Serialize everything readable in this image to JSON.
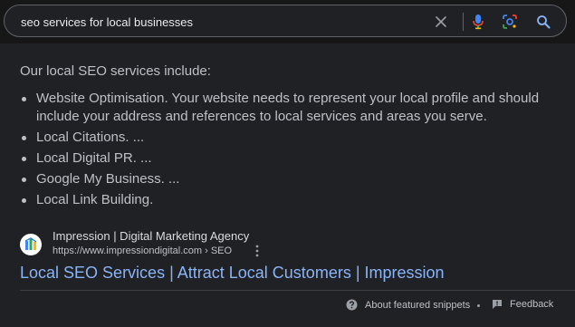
{
  "search": {
    "query": "seo services for local businesses",
    "icons": [
      "close-icon",
      "microphone-icon",
      "lens-icon",
      "search-icon"
    ]
  },
  "snippet": {
    "heading": "Our local SEO services include:",
    "items": [
      "Website Optimisation. Your website needs to represent your local profile and should include your address and references to local services and areas you serve.",
      "Local Citations. ...",
      "Local Digital PR. ...",
      "Google My Business. ...",
      "Local Link Building."
    ]
  },
  "result": {
    "site_name": "Impression | Digital Marketing Agency",
    "url": "https://www.impressiondigital.com › SEO",
    "title": "Local SEO Services | Attract Local Customers | Impression"
  },
  "footer": {
    "about_label": "About featured snippets",
    "feedback_label": "Feedback"
  },
  "colors": {
    "background": "#202124",
    "link": "#8ab4f8",
    "text": "#bdc1c6"
  }
}
